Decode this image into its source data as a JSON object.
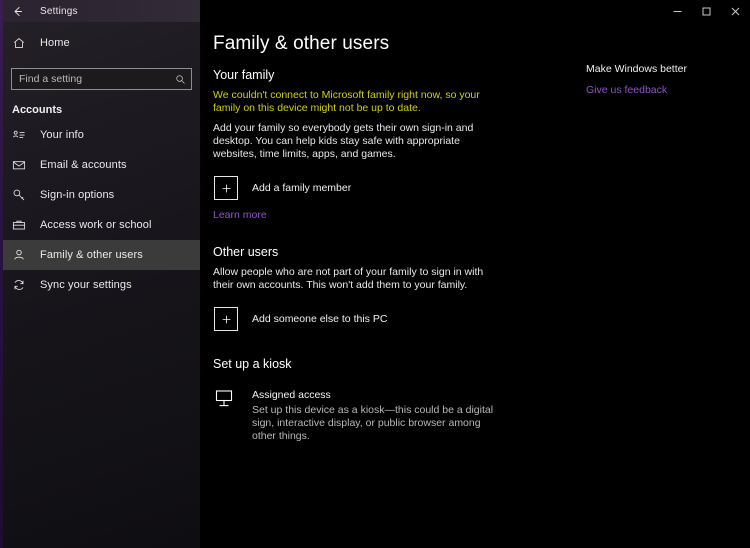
{
  "window": {
    "app_title": "Settings",
    "back_icon": "back-arrow-icon",
    "minimize_label": "─",
    "maximize_label": "□",
    "close_label": "✕"
  },
  "sidebar": {
    "home_label": "Home",
    "home_icon": "home-icon",
    "search": {
      "placeholder": "Find a setting",
      "value": "",
      "icon": "search-icon"
    },
    "group_header": "Accounts",
    "items": [
      {
        "label": "Your info",
        "icon": "id-card-icon",
        "selected": false
      },
      {
        "label": "Email & accounts",
        "icon": "envelope-icon",
        "selected": false
      },
      {
        "label": "Sign-in options",
        "icon": "key-icon",
        "selected": false
      },
      {
        "label": "Access work or school",
        "icon": "briefcase-icon",
        "selected": false
      },
      {
        "label": "Family & other users",
        "icon": "person-icon",
        "selected": true
      },
      {
        "label": "Sync your settings",
        "icon": "sync-icon",
        "selected": false
      }
    ]
  },
  "main": {
    "page_title": "Family & other users",
    "your_family": {
      "heading": "Your family",
      "warning": "We couldn't connect to Microsoft family right now, so your family on this device might not be up to date.",
      "description": "Add your family so everybody gets their own sign-in and desktop. You can help kids stay safe with appropriate websites, time limits, apps, and games.",
      "add_button": "Add a family member",
      "add_icon": "plus-icon",
      "learn_more": "Learn more"
    },
    "other_users": {
      "heading": "Other users",
      "description": "Allow people who are not part of your family to sign in with their own accounts. This won't add them to your family.",
      "add_button": "Add someone else to this PC",
      "add_icon": "plus-icon"
    },
    "kiosk": {
      "heading": "Set up a kiosk",
      "icon": "monitor-icon",
      "title": "Assigned access",
      "description": "Set up this device as a kiosk—this could be a digital sign, interactive display, or public browser among other things."
    }
  },
  "right_rail": {
    "title": "Make Windows better",
    "link": "Give us feedback"
  },
  "colors": {
    "accent": "#9a4dde",
    "link": "#8f52c9",
    "warning": "#cfcf15",
    "selected_row": "#3b3b3b",
    "background": "#000000"
  }
}
